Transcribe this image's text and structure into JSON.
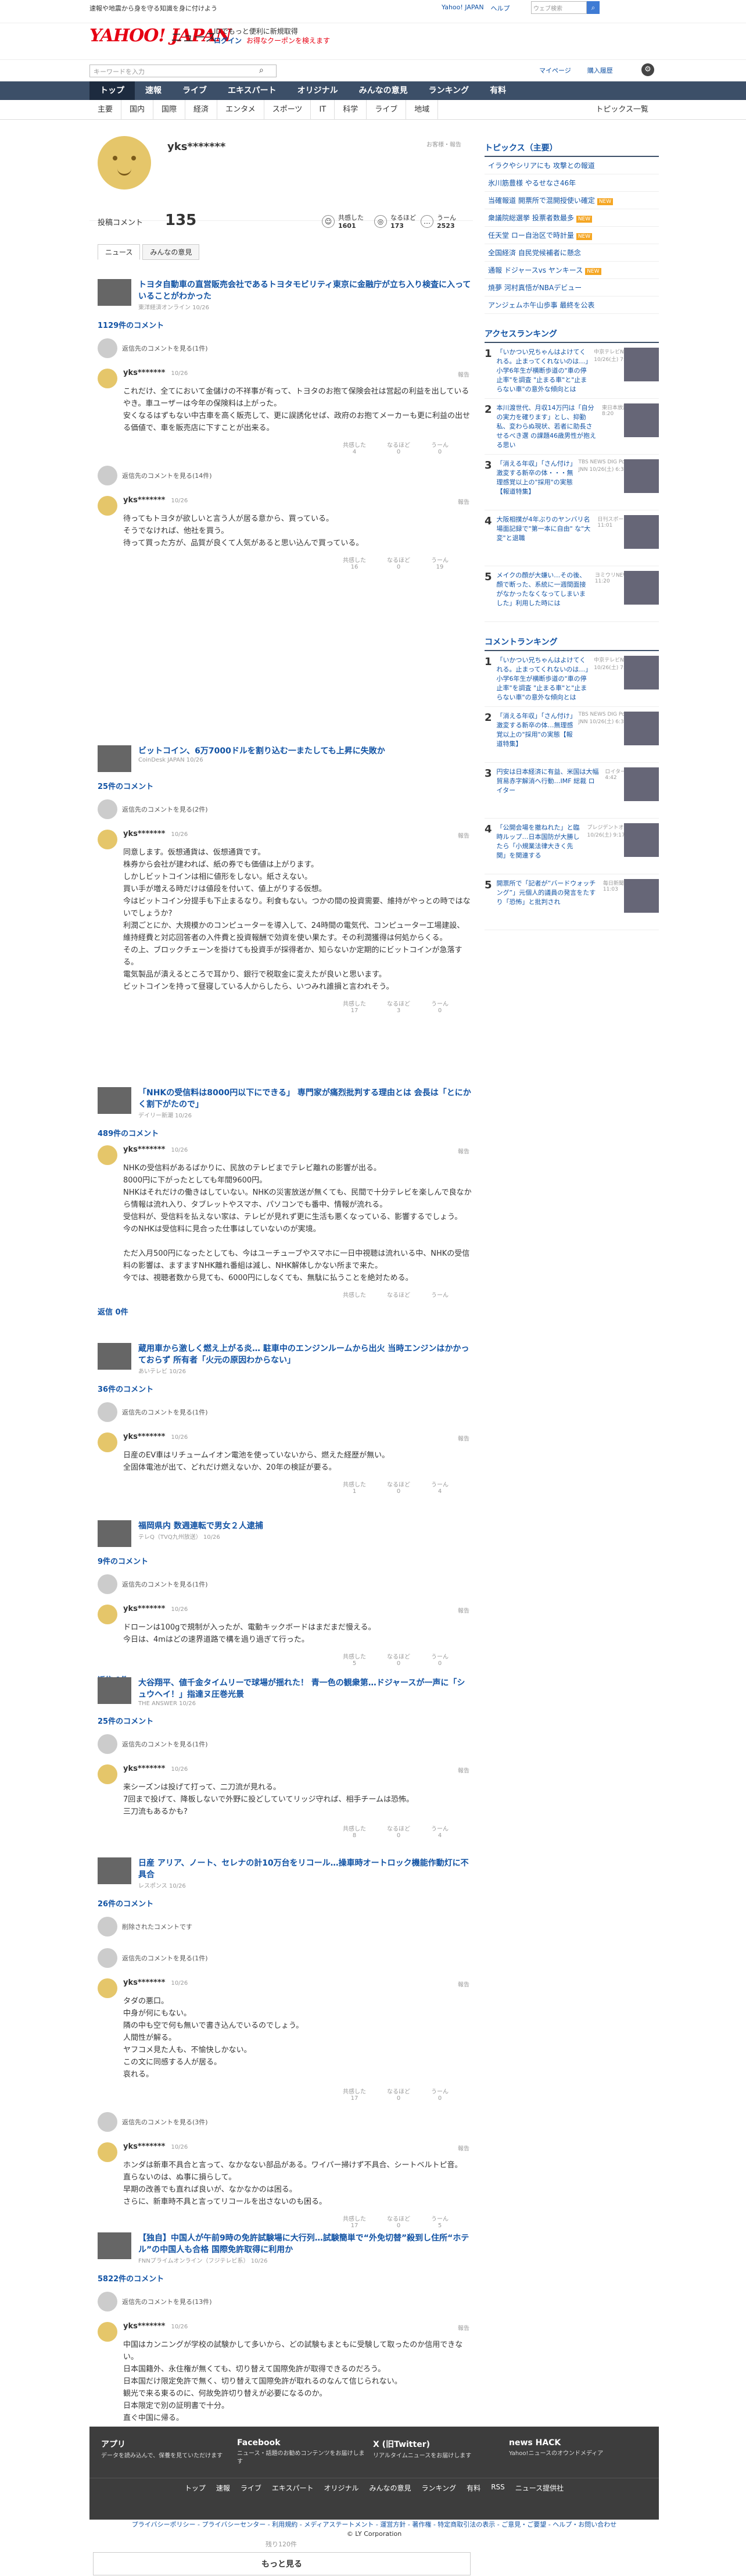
{
  "top": {
    "note": "速報や地震から身を守る知識を身に付けよう",
    "links": [
      "Yahoo! JAPAN",
      "ヘルプ"
    ],
    "search_placeholder": "ウェブ検索"
  },
  "header": {
    "logo": "YAHOO! JAPAN",
    "service": "ニュース",
    "promo1": "IDでもっと便利に新規取得",
    "login": "ログイン",
    "coupon": "お得なクーポンを検えます"
  },
  "search": {
    "placeholder": "キーワードを入力",
    "links": [
      "マイページ",
      "購入履歴"
    ]
  },
  "gnav": [
    "トップ",
    "速報",
    "ライブ",
    "エキスパート",
    "オリジナル",
    "みんなの意見",
    "ランキング",
    "有料"
  ],
  "cnav": [
    "主要",
    "国内",
    "国際",
    "経済",
    "エンタメ",
    "スポーツ",
    "IT",
    "科学",
    "ライブ",
    "地域"
  ],
  "cnav_list": "トピックス一覧",
  "profile": {
    "name": "yks*******",
    "report": "お客様・報告",
    "count_label": "投稿コメント",
    "count": "135",
    "stats": [
      {
        "label": "共感した",
        "value": "1601"
      },
      {
        "label": "なるほど",
        "value": "173"
      },
      {
        "label": "うーん",
        "value": "2523"
      }
    ],
    "tabs": [
      "ニュース",
      "みんなの意見"
    ]
  },
  "articles": [
    {
      "title": "トヨタ自動車の直営販売会社であるトヨタモビリティ東京に金融庁が立ち入り検査に入っていることがわかった",
      "source": "東洋経済オンライン 10/26",
      "count": "1129件のコメント",
      "reply": "返信先のコメントを見る(1件)",
      "time": "10/26",
      "text": "これだけ、全てにおいて金儲けの不祥事が有って、トヨタのお抱て保険会社は営起の利益を出しているやき。車ユーザーは今年の保険料は上がった。\n安くなるはずもない中古車を高く販売して、更に誤誘化せば、政府のお抱てメーカーも更に利益の出せる価値で、車を販売店に下すことが出来る。",
      "r": [
        "4",
        "0",
        "0"
      ],
      "reply2": "返信先のコメントを見る(14件)",
      "text2": "待ってもトヨタが欲しいと言う人が居る意から、買っている。\nそうでなければ、他社を買う。\n待って買った方が、品質が良くて人気があると思い込んで買っている。",
      "r2": [
        "16",
        "0",
        "19"
      ]
    },
    {
      "title": "ビットコイン、6万7000ドルを割り込む一またしても上昇に失敗か",
      "source": "CoinDesk JAPAN 10/26",
      "count": "25件のコメント",
      "reply": "返信先のコメントを見る(2件)",
      "time": "10/26",
      "text": "同意します。仮想通貨は、仮想通貨です。\n株券から会社が建われば、紙の券でも価値は上がります。\nしかしビットコインは相に値形をしない。紙さえない。\n買い手が増える時だけは値段を付いて、値上がりする仮想。\n今はビットコイン分提手も下止まるなり。利食もない。つかの間の投資需要、維持がやっとの時ではないでしょうか?\n利潤ごとにか、大規模かのコンピューターを導入して、24時間の電気代、コンピューター工場建設、維持経費と対応回答者の入件費と投資報酬で効資を使い果たす。その利潤獲得は何処からくる。\nその上、ブロックチェーンを掛けても投資手が採得者か、知らないか定期的にビットコインが急落する。\n電気製品が潰えるところで耳かり、銀行で税取金に変えたが良いと思います。\nビットコインを持って昼寝している人からしたら、いつみれ誰損と言われそう。",
      "r": [
        "17",
        "3",
        "0"
      ]
    },
    {
      "title": "「NHKの受信料は8000円以下にできる」 専門家が痛烈批判する理由とは 会長は「とにかく割下がたので」",
      "source": "デイリー新潮 10/26",
      "count": "489件のコメント",
      "time": "10/26",
      "text": "NHKの受信料があるばかりに、民放のテレビまでテレビ離れの影響が出る。\n8000円に下がったとしても年間9600円。\nNHKはそれだけの働きはしていない。NHKの災害放送が無くても、民間で十分テレビを楽しんで良なから情報は流れ入り、タブレットやスマホ、パソコンでも番中、情報が流れる。\n受信料が、受信料を払えない家は、テレビが見れず更に生活も悪くなっている、影響するでしょう。\n今のNHKは受信料に見合った仕事はしていないのが実境。\n\nただ入月500円になったとしても、今はユーチューブやスマホに一日中視聴は流れいる中、NHKの受信料の影響は、ますますNHK離れ番組は減し、NHK解体しかない所まで来た。\n今では、視聴者数から見ても、6000円にしなくても、無駄に払うことを絶対ためる。",
      "r": [
        "",
        "",
        ""
      ],
      "reply_link": "返信 0件"
    },
    {
      "title": "蔵用車から激しく燃え上がる炎… 駐車中のエンジンルームから出火 当時エンジンはかかっておらず 所有者「火元の原因わからない」",
      "source": "あいテレビ 10/26",
      "count": "36件のコメント",
      "reply": "返信先のコメントを見る(1件)",
      "time": "10/26",
      "text": "日産のEV車はリチュームイオン電池を使っていないから、燃えた経歴が無い。\n全固体電池が出て、どれだけ燃えないか、20年の検証が要る。",
      "r": [
        "1",
        "0",
        "4"
      ]
    },
    {
      "title": "福岡県内 数週連転で男女２人逮捕",
      "source": "テレQ（TVQ九州放送） 10/26",
      "count": "9件のコメント",
      "reply": "返信先のコメントを見る(1件)",
      "time": "10/26",
      "text": "ドローンは100gで規制が入ったが、電動キックボードはまだまだ慢える。\n今日は、4mはどの速界道路で構を過り過ぎて行った。",
      "r": [
        "5",
        "0",
        "0"
      ],
      "reply_link": "返信 0件"
    },
    {
      "title": "大谷翔平、値千金タイムリーで球場が揺れた！ 青一色の観衆第…ドジャースが一声に「シュウヘイ！」指達ヌ圧巻光景",
      "source": "THE ANSWER 10/26",
      "count": "25件のコメント",
      "reply": "返信先のコメントを見る(1件)",
      "time": "10/26",
      "text": "来シーズンは投げて打って、二刀流が見れる。\n7回まで投げて、降板しないで外野に投どしていてリッジ守れば、相手チームは恐怖。\n三刀流もあるかも?",
      "r": [
        "8",
        "0",
        "4"
      ]
    },
    {
      "title": "日産 アリア、ノート、セレナの計10万台をリコール…操車時オートロック機能作動灯に不具合",
      "source": "レスポンス 10/26",
      "count": "26件のコメント",
      "deleted": "削除されたコメントです",
      "reply": "返信先のコメントを見る(1件)",
      "time": "10/26",
      "text": "タダの悪口。\n中身が何にもない。\n隣の中も空で何も無いで書き込んでいるのでしょう。\n人間性が解る。\nヤフコメ見た人も、不愉快しかない。\nこの文に同感する人が居る。\n哀れる。",
      "r": [
        "17",
        "0",
        "0"
      ],
      "reply2": "返信先のコメントを見る(3件)",
      "text2": "ホンダは新車不具合と言って、なかなない部品がある。ワイパー掃けず不具合、シートベルトピ音。\n直らないのは、ぬ事に損らして。\n早期の改善でも直れば良いが、なかなかのは困る。\nさらに、新車時不具と言ってリコールを出さないのも困る。",
      "r2": [
        "17",
        "0",
        "5"
      ]
    },
    {
      "title": "【独自】中国人が午前9時の免許試験場に大行列…試験簡単で“外免切替”殺到し住所“ホテル”の中国人も合格 国際免許取得に利用か",
      "source": "FNNプライムオンライン（フジテレビ系） 10/26",
      "count": "5822件のコメント",
      "reply": "返信先のコメントを見る(13件)",
      "time": "10/26",
      "text": "中国はカンニングが学校の試験かして多いから、どの試験もまともに受験して取ったのか信用できない。\n日本国籍外、永住権が無くても、切り替えて国際免許が取得できるのだろう。\n日本国だけ限定免許で無く、切り替えて国際免許が取れるのなんて信じられない。\n観光で来る東るのに、何故免許切り替えが必要になるのか。\n日本限定で別の証明書で十分。\n直ぐ中国に帰る。",
      "r": [
        "19",
        "1",
        "2"
      ]
    }
  ],
  "more": {
    "remain": "残り120件",
    "button": "もっと見る"
  },
  "react_labels": [
    "共感した",
    "なるほど",
    "うーん"
  ],
  "report_label": "報告",
  "sidebar": {
    "topics_head": "トピックス（主要）",
    "topics": [
      "イラクやシリアにも 攻撃との報道",
      "氷川筋豊様 やるせなさ46年",
      "当確報道 開票所で混開授使い確定",
      "衆議院総選挙 投票者数最多",
      "任天堂 ロー自治区で時計量",
      "全国経済 自民党候補者に懸念",
      "通報 ドジャースvs ヤンキース",
      "焼夢 河村真悟がNBAデビュー",
      "アンジェムホ午山歩事 最終を公表"
    ],
    "topics_new": [
      2,
      3,
      4,
      6
    ],
    "access_head": "アクセスランキング",
    "access": [
      {
        "t": "「いかつい兄ちゃんはよけてくれる。止まってくれないのは…」小学6年生が横断歩道の\"車の停止率\"を調査 \"止まる車\"と\"止まらない車\"の意外な傾向とは",
        "s": "中京テレビNEWS 10/26(土) 7:00"
      },
      {
        "t": "本川渡世代、月収14万円は「自分の実力を確ります」とし、抑勤私、変わらぬ現状、若者に助長させるべき選 の課題46歳男性が抱える思い",
        "s": "東日本放送 10/26(土) 8:20"
      },
      {
        "t": "「消える年収」「さん付け」激変する新卒の体・・・無理感覚以上の\"採用\"の実態【報道特集】",
        "s": "TBS NEWS DIG Powered by JNN 10/26(土) 6:32"
      },
      {
        "t": "大阪相撲が4年ぶりのヤンバリ名場面記録で\"第一本に自由\" な\"大変\"と退職",
        "s": "日刊スポーツ 10/26(土) 11:01"
      },
      {
        "t": "メイクの顔が大嫌い…その後、顔で断った、系統に一週間面接がなかったなくなってしまいました」利用した時には",
        "s": "ヨミウリNEWS 10/26(土) 11:20"
      }
    ],
    "rank_head": "コメントランキング",
    "ranks": [
      {
        "t": "「いかつい兄ちゃんはよけてくれる。止まってくれないのは…」小学6年生が横断歩道の\"車の停止率\"を調査 \"止まる車\"と\"止まらない車\"の意外な傾向とは",
        "s": "中京テレビNEWS 10/26(土) 7:00"
      },
      {
        "t": "「消える年収」「さん付け」激変する新卒の体…無理感覚以上の\"採用\"の実態【報道特集】",
        "s": "TBS NEWS DIG Powered by JNN 10/26(土) 6:32"
      },
      {
        "t": "円安は日本経済に有益、米国は大幅貿易赤字解消へ行動…IMF 総裁 ロイター",
        "s": "ロイター 10/26(土) 4:42"
      },
      {
        "t": "「公開会場を撤ねれた」と臨時ルップ…日本国防が大勝したら「小規業法律大きく先関」を関連する",
        "s": "プレジデントオンライン 10/26(土) 9:17"
      },
      {
        "t": "開票所で「記者が”バードウォッチング”」元個人的議員の発言をたすり「恐怖」と批判され",
        "s": "毎日新聞 10/26(土) 11:03"
      }
    ]
  },
  "footer": {
    "apps": [
      {
        "name": "アプリ",
        "desc": "データを読み込んで、保養を見ていただけます"
      },
      {
        "name": "Facebook",
        "desc": "ニュース・話題のお勧めコンテンツをお届けします"
      },
      {
        "name": "X (旧Twitter)",
        "desc": "リアルタイムニュースをお届けします"
      },
      {
        "name": "news HACK",
        "desc": "Yahoo!ニュースのオウンドメディア"
      }
    ],
    "nav": [
      "トップ",
      "速報",
      "ライブ",
      "エキスパート",
      "オリジナル",
      "みんなの意見",
      "ランキング",
      "有料",
      "RSS",
      "ニュース提供社"
    ],
    "legal": "プライバシーポリシー - プライバシーセンター - 利用規約 - メディアステートメント - 運営方針 - 著作権 - 特定商取引法の表示 - ご意見・ご要望 - ヘルプ・お問い合わせ",
    "copyright": "© LY Corporation"
  },
  "colors": {
    "nav": "#3c4f68",
    "link": "#1253a4",
    "accent": "#e60012"
  }
}
